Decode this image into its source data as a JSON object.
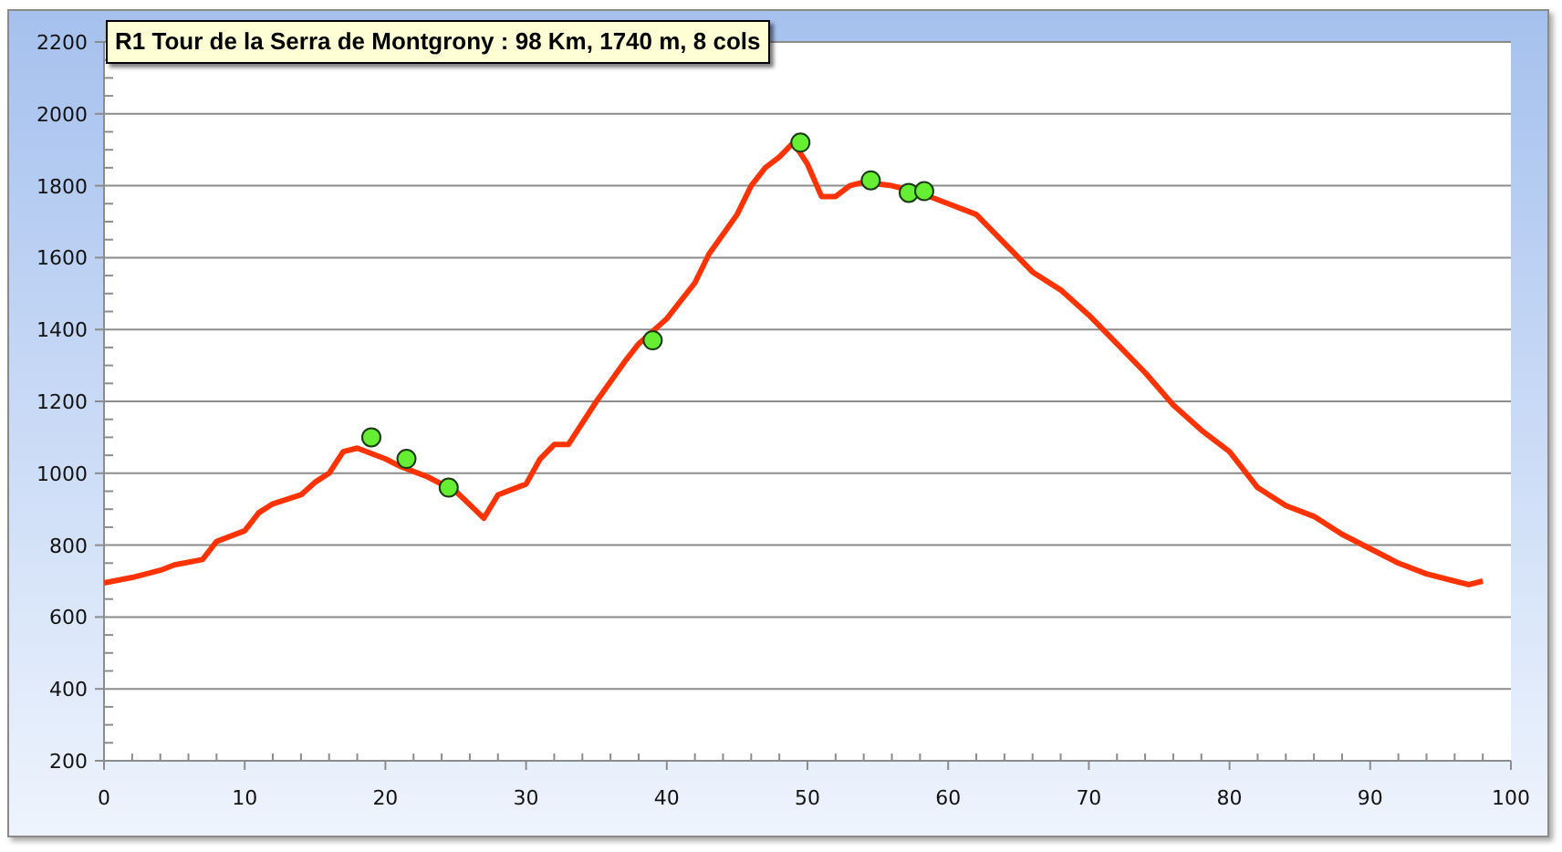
{
  "chart": {
    "chart_data": {
      "type": "line",
      "title": "R1 Tour de la Serra de Montgrony : 98 Km, 1740 m, 8 cols",
      "x": [
        0,
        2,
        4,
        5,
        7,
        8,
        10,
        11,
        12,
        14,
        15,
        16,
        17,
        18,
        19,
        20,
        21,
        21.5,
        23,
        24.5,
        25,
        27,
        28,
        30,
        31,
        32,
        33,
        35,
        37,
        38,
        39,
        40,
        42,
        43,
        45,
        46,
        47,
        48,
        49,
        49.5,
        50,
        51,
        52,
        53,
        54,
        54.5,
        56,
        57.2,
        58,
        58.3,
        60,
        62,
        64,
        66,
        68,
        70,
        72,
        74,
        76,
        78,
        80,
        82,
        84,
        86,
        88,
        90,
        92,
        94,
        96,
        97,
        98
      ],
      "series": [
        {
          "color": "#ff3300",
          "values": [
            695,
            710,
            730,
            745,
            760,
            810,
            840,
            890,
            915,
            940,
            975,
            1000,
            1060,
            1070,
            null,
            1040,
            1020,
            null,
            990,
            null,
            950,
            875,
            940,
            970,
            1040,
            1080,
            1080,
            1200,
            1310,
            1360,
            null,
            1430,
            1530,
            1610,
            1720,
            1800,
            1850,
            1880,
            1920,
            null,
            1860,
            1770,
            1770,
            1800,
            1810,
            null,
            1800,
            null,
            1780,
            null,
            1750,
            1720,
            1640,
            1560,
            1510,
            1440,
            1360,
            1280,
            1190,
            1120,
            1060,
            960,
            910,
            880,
            830,
            790,
            750,
            720,
            700,
            690,
            700
          ]
        },
        {
          "type": "scatter",
          "color": "#66ee33",
          "values": [
            null,
            null,
            null,
            null,
            null,
            null,
            null,
            null,
            null,
            null,
            null,
            null,
            null,
            null,
            1100,
            null,
            null,
            1040,
            null,
            960,
            null,
            null,
            null,
            null,
            null,
            null,
            null,
            null,
            null,
            null,
            1370,
            null,
            null,
            null,
            null,
            null,
            null,
            null,
            null,
            1920,
            null,
            null,
            null,
            null,
            null,
            1815,
            null,
            1780,
            null,
            1785,
            null,
            null,
            null,
            null,
            null,
            null,
            null,
            null,
            null,
            null,
            null,
            null,
            null,
            null,
            null,
            null,
            null,
            null,
            null,
            null,
            null
          ]
        }
      ],
      "grid": true,
      "xlim": [
        0,
        100
      ],
      "ylim": [
        200,
        2200
      ],
      "xticks": [
        0,
        10,
        20,
        30,
        40,
        50,
        60,
        70,
        80,
        90,
        100
      ],
      "yticks": [
        200,
        400,
        600,
        800,
        1000,
        1200,
        1400,
        1600,
        1800,
        2000,
        2200
      ]
    }
  }
}
